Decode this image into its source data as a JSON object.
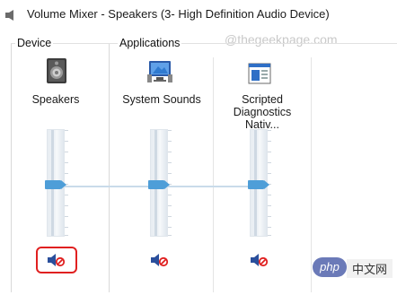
{
  "window": {
    "title": "Volume Mixer - Speakers (3- High Definition Audio Device)"
  },
  "watermark": "@thegeekpage.com",
  "groups": {
    "device": "Device",
    "applications": "Applications"
  },
  "channels": [
    {
      "name": "Speakers",
      "icon": "speaker-icon",
      "volume_percent": 48,
      "muted": true
    },
    {
      "name": "System Sounds",
      "icon": "system-sounds-icon",
      "volume_percent": 48,
      "muted": true
    },
    {
      "name": "Scripted Diagnostics Nativ...",
      "icon": "application-window-icon",
      "volume_percent": 48,
      "muted": true
    }
  ],
  "brand": {
    "php_logo": "php",
    "php_text": "中文网"
  },
  "colors": {
    "thumb": "#4e9ed8",
    "highlight": "#e02020",
    "mute_red": "#e02020"
  }
}
